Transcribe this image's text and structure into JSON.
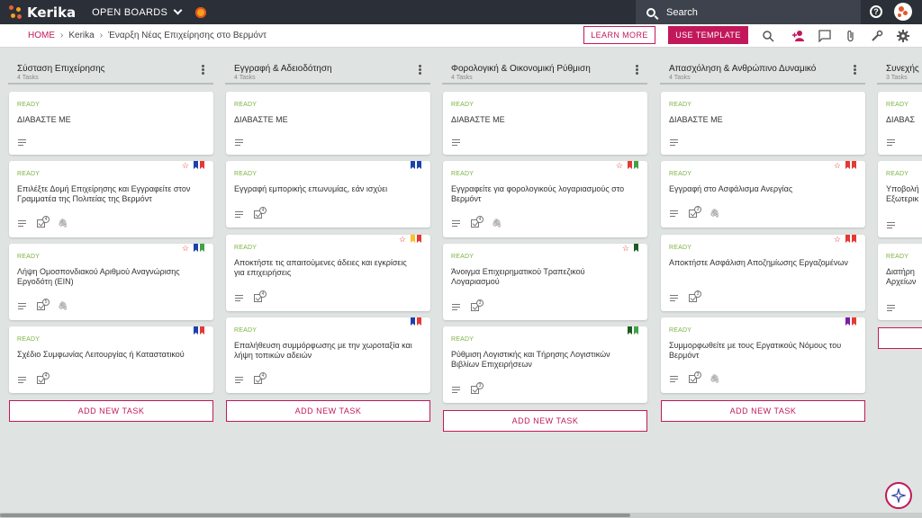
{
  "app": {
    "logo_text": "Kerika",
    "open_boards_label": "OPEN BOARDS"
  },
  "search": {
    "label": "Search"
  },
  "help": {
    "label": "?"
  },
  "breadcrumb": {
    "home": "HOME",
    "org": "Kerika",
    "board": "Έναρξη Νέας Επιχείρησης στο Βερμόντ"
  },
  "actions": {
    "learn_more": "LEARN MORE",
    "use_template": "USE TEMPLATE"
  },
  "toolbar_icons": [
    "search-icon",
    "add-user-icon",
    "chat-icon",
    "attachment-icon",
    "wrench-icon",
    "settings-icon"
  ],
  "colors": {
    "accent": "#c2185b",
    "ready": "#7cb342",
    "topbar": "#2b2f37",
    "board_bg": "#dfe3e1"
  },
  "columns": [
    {
      "title": "Σύσταση Επιχείρησης",
      "count": "4 Tasks",
      "add_label": "ADD NEW TASK",
      "cards": [
        {
          "status": "READY",
          "title": "ΔΙΑΒΑΣΤΕ ΜΕ"
        },
        {
          "status": "READY",
          "title": "Επιλέξτε Δομή Επιχείρησης και Εγγραφείτε στον Γραμματέα της Πολιτείας της Βερμόντ",
          "check": "4"
        },
        {
          "status": "READY",
          "title": "Λήψη Ομοσπονδιακού Αριθμού Αναγνώρισης Εργοδότη (EIN)",
          "check": "5"
        },
        {
          "status": "READY",
          "title": "Σχέδιο Συμφωνίας Λειτουργίας ή Καταστατικού",
          "check": "4"
        }
      ]
    },
    {
      "title": "Εγγραφή & Αδειοδότηση",
      "count": "4 Tasks",
      "add_label": "ADD NEW TASK",
      "cards": [
        {
          "status": "READY",
          "title": "ΔΙΑΒΑΣΤΕ ΜΕ"
        },
        {
          "status": "READY",
          "title": "Εγγραφή εμπορικής επωνυμίας, εάν ισχύει",
          "check": "4"
        },
        {
          "status": "READY",
          "title": "Αποκτήστε τις απαιτούμενες άδειες και εγκρίσεις για επιχειρήσεις",
          "check": "4"
        },
        {
          "status": "READY",
          "title": "Επαλήθευση συμμόρφωσης με την χωροταξία και λήψη τοπικών αδειών",
          "check": "4"
        }
      ]
    },
    {
      "title": "Φορολογική & Οικονομική Ρύθμιση",
      "count": "4 Tasks",
      "add_label": "ADD NEW TASK",
      "cards": [
        {
          "status": "READY",
          "title": "ΔΙΑΒΑΣΤΕ ΜΕ"
        },
        {
          "status": "READY",
          "title": "Εγγραφείτε για φορολογικούς λογαριασμούς στο Βερμόντ",
          "check": "4"
        },
        {
          "status": "READY",
          "title": "Άνοιγμα Επιχειρηματικού Τραπεζικού Λογαριασμού",
          "check": "3"
        },
        {
          "status": "READY",
          "title": "Ρύθμιση Λογιστικής και Τήρησης Λογιστικών Βιβλίων Επιχειρήσεων",
          "check": "3"
        }
      ]
    },
    {
      "title": "Απασχόληση & Ανθρώπινο Δυναμικό",
      "count": "4 Tasks",
      "add_label": "ADD NEW TASK",
      "cards": [
        {
          "status": "READY",
          "title": "ΔΙΑΒΑΣΤΕ ΜΕ"
        },
        {
          "status": "READY",
          "title": "Εγγραφή στο Ασφάλισμα Ανεργίας",
          "check": "3"
        },
        {
          "status": "READY",
          "title": "Αποκτήστε Ασφάλιση Αποζημίωσης Εργαζομένων",
          "check": "3"
        },
        {
          "status": "READY",
          "title": "Συμμορφωθείτε με τους Εργατικούς Νόμους του Βερμόντ",
          "check": "3"
        }
      ]
    },
    {
      "title": "Συνεχής",
      "count": "3 Tasks",
      "cards": [
        {
          "status": "READY",
          "title": "ΔΙΑΒΑΣ"
        },
        {
          "status": "READY",
          "title": "Υποβολή Εξωτερικ"
        },
        {
          "status": "READY",
          "title": "Διατήρη Αρχείων"
        }
      ]
    }
  ]
}
